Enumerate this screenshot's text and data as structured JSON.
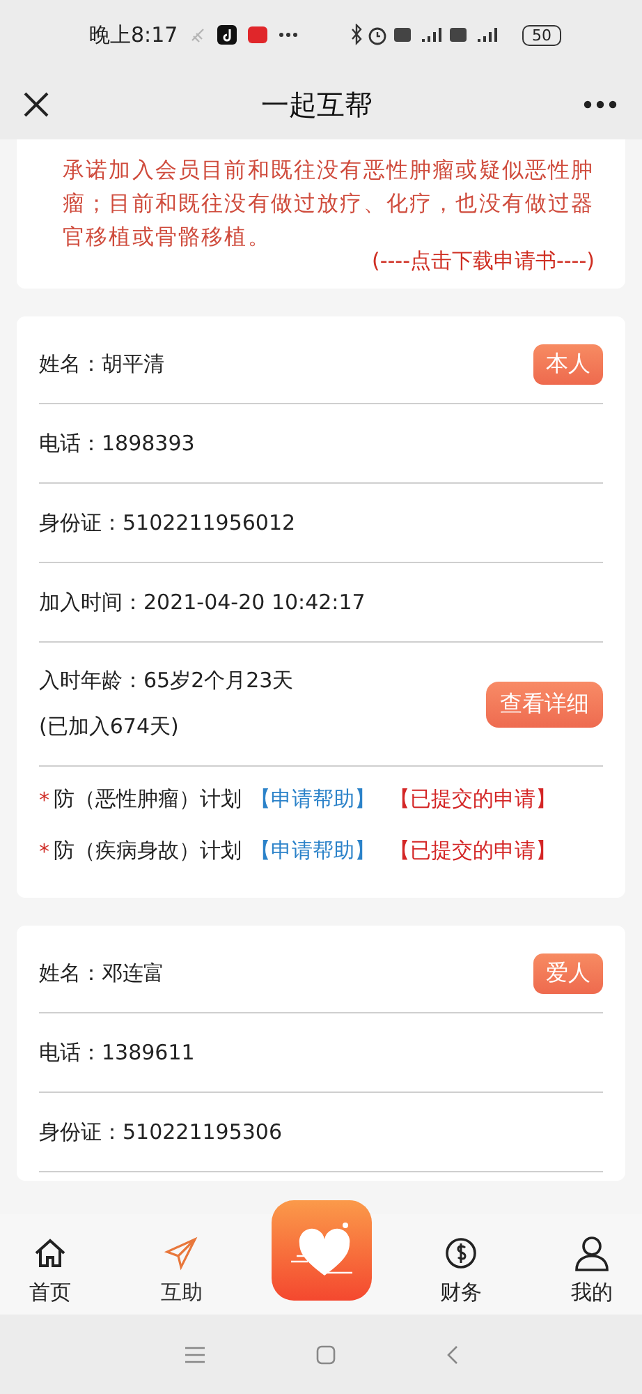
{
  "status_bar": {
    "time": "晚上8:17",
    "battery": "50"
  },
  "nav": {
    "title": "一起互帮"
  },
  "notice": {
    "text": "承诺加入会员目前和既往没有恶性肿瘤或疑似恶性肿瘤；目前和既往没有做过放疗、化疗，也没有做过器官移植或骨骼移植。",
    "link": "(----点击下载申请书----)"
  },
  "members": [
    {
      "role": "本人",
      "fields": [
        {
          "label": "姓名：",
          "value": "胡平清"
        },
        {
          "label": "电话：",
          "value": "1898393"
        },
        {
          "label": "身份证：",
          "value": "5102211956012"
        },
        {
          "label": "加入时间：",
          "value": "2021-04-20 10:42:17"
        }
      ],
      "age": {
        "label": "入时年龄：",
        "value": "65岁2个月23天",
        "joined": "(已加入674天)",
        "button": "查看详细"
      },
      "plans": [
        {
          "mark": "*",
          "name": "防（恶性肿瘤）计划",
          "apply": "【申请帮助】",
          "submitted": "【已提交的申请】"
        },
        {
          "mark": "*",
          "name": "防（疾病身故）计划",
          "apply": "【申请帮助】",
          "submitted": "【已提交的申请】"
        }
      ]
    },
    {
      "role": "爱人",
      "fields": [
        {
          "label": "姓名：",
          "value": "邓连富"
        },
        {
          "label": "电话：",
          "value": "1389611"
        },
        {
          "label": "身份证：",
          "value": "510221195306"
        }
      ]
    }
  ],
  "tabs": [
    {
      "kind": "tab",
      "label": "首页",
      "selected": false
    },
    {
      "kind": "tab",
      "label": "互助",
      "selected": true
    },
    {
      "kind": "center"
    },
    {
      "kind": "tab",
      "label": "财务",
      "selected": false
    },
    {
      "kind": "tab",
      "label": "我的",
      "selected": false
    }
  ]
}
